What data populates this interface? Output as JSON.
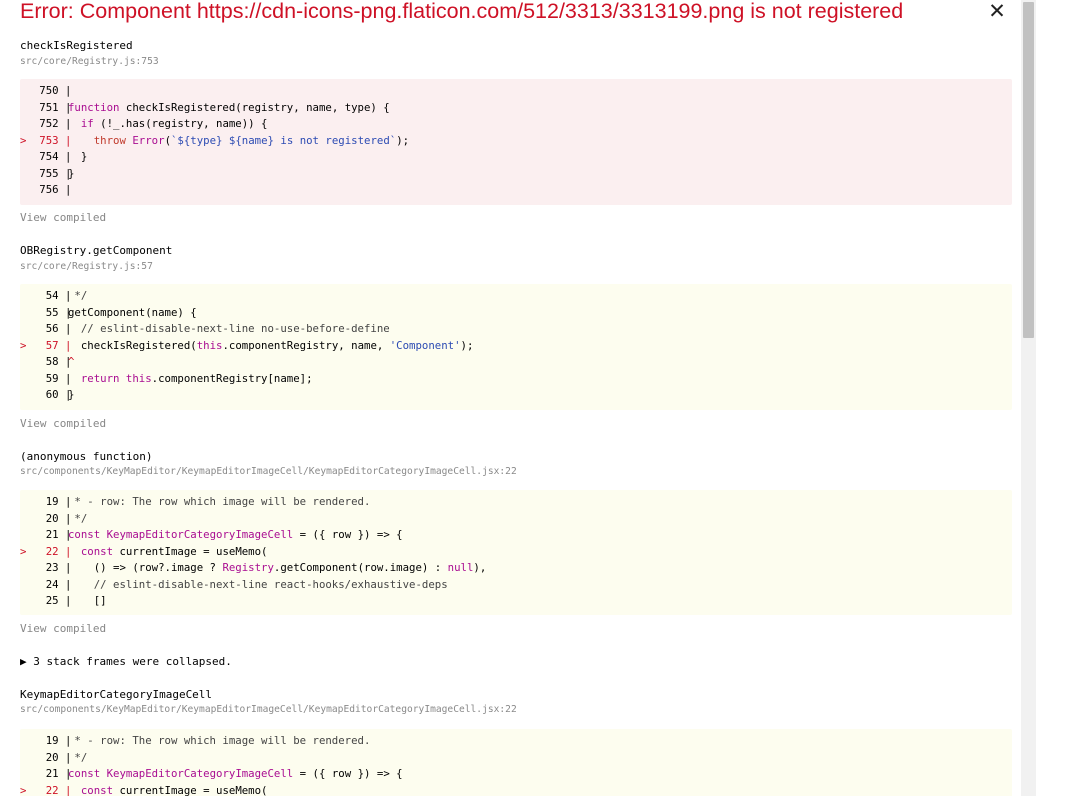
{
  "error": {
    "title": "Error: Component https://cdn-icons-png.flaticon.com/512/3313/3313199.png is not registered",
    "close_glyph": "✕"
  },
  "frames": [
    {
      "function": "checkIsRegistered",
      "location": "src/core/Registry.js:753",
      "view_compiled": "View compiled",
      "lines": [
        {
          "num": "750",
          "text": "",
          "hl": false
        },
        {
          "num": "751",
          "text": "function checkIsRegistered(registry, name, type) {",
          "hl": false
        },
        {
          "num": "752",
          "text": "  if (!_.has(registry, name)) {",
          "hl": false
        },
        {
          "num": "753",
          "text": "    throw Error(`${type} ${name} is not registered`);",
          "hl": true
        },
        {
          "num": "754",
          "text": "  }",
          "hl": false
        },
        {
          "num": "755",
          "text": "}",
          "hl": false
        },
        {
          "num": "756",
          "text": "",
          "hl": false
        }
      ]
    },
    {
      "function": "OBRegistry.getComponent",
      "location": "src/core/Registry.js:57",
      "view_compiled": "View compiled",
      "lines": [
        {
          "num": "54",
          "text": " */",
          "hl": false
        },
        {
          "num": "55",
          "text": "getComponent(name) {",
          "hl": false
        },
        {
          "num": "56",
          "text": "  // eslint-disable-next-line no-use-before-define",
          "hl": false
        },
        {
          "num": "57",
          "text": "  checkIsRegistered(this.componentRegistry, name, 'Component');",
          "hl": true
        },
        {
          "num": "58",
          "text": "^",
          "hl": false,
          "caret": true
        },
        {
          "num": "59",
          "text": "  return this.componentRegistry[name];",
          "hl": false
        },
        {
          "num": "60",
          "text": "}",
          "hl": false
        }
      ]
    },
    {
      "function": "(anonymous function)",
      "location": "src/components/KeyMapEditor/KeymapEditorImageCell/KeymapEditorCategoryImageCell.jsx:22",
      "view_compiled": "View compiled",
      "lines": [
        {
          "num": "19",
          "text": " * - row: The row which image will be rendered.",
          "hl": false
        },
        {
          "num": "20",
          "text": " */",
          "hl": false
        },
        {
          "num": "21",
          "text": "const KeymapEditorCategoryImageCell = ({ row }) => {",
          "hl": false
        },
        {
          "num": "22",
          "text": "  const currentImage = useMemo(",
          "hl": true
        },
        {
          "num": "23",
          "text": "    () => (row?.image ? Registry.getComponent(row.image) : null),",
          "hl": false
        },
        {
          "num": "24",
          "text": "    // eslint-disable-next-line react-hooks/exhaustive-deps",
          "hl": false
        },
        {
          "num": "25",
          "text": "    []",
          "hl": false
        }
      ]
    },
    {
      "function": "KeymapEditorCategoryImageCell",
      "location": "src/components/KeyMapEditor/KeymapEditorImageCell/KeymapEditorCategoryImageCell.jsx:22",
      "view_compiled": "",
      "lines": [
        {
          "num": "19",
          "text": " * - row: The row which image will be rendered.",
          "hl": false
        },
        {
          "num": "20",
          "text": " */",
          "hl": false
        },
        {
          "num": "21",
          "text": "const KeymapEditorCategoryImageCell = ({ row }) => {",
          "hl": false
        },
        {
          "num": "22",
          "text": "  const currentImage = useMemo(",
          "hl": true
        }
      ]
    }
  ],
  "collapsed": "▶ 3 stack frames were collapsed."
}
